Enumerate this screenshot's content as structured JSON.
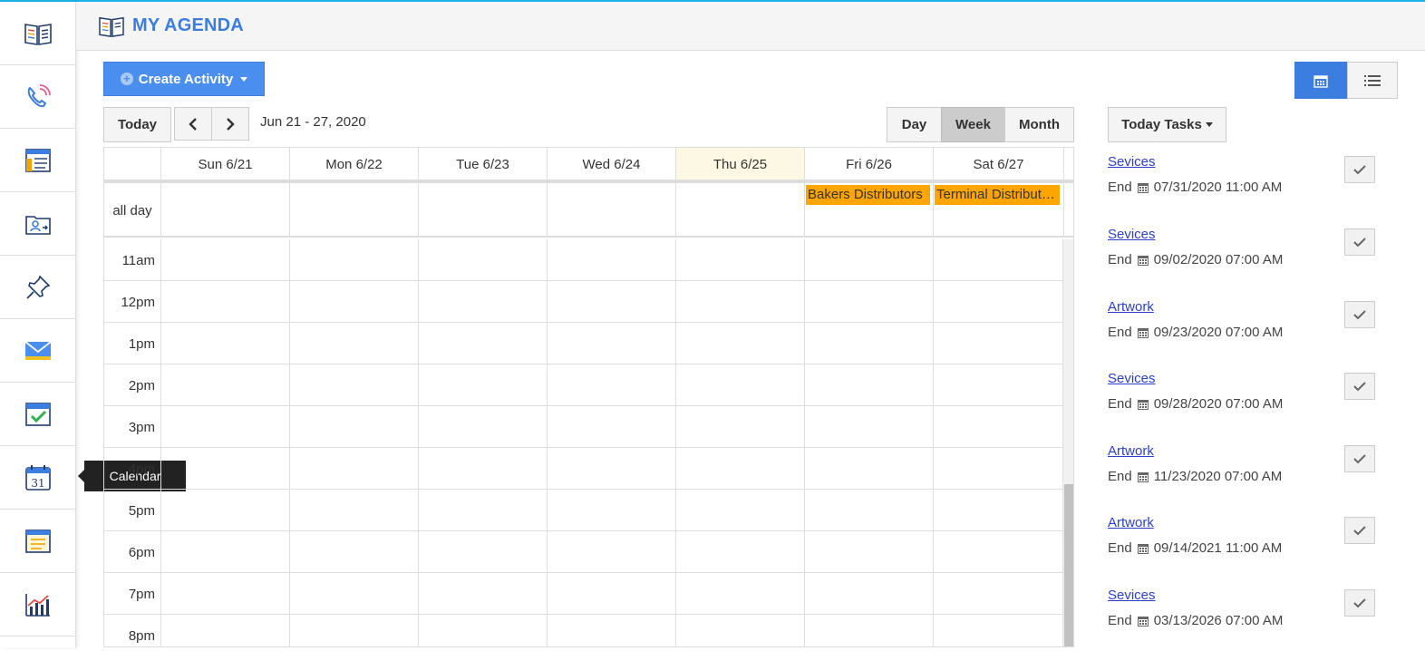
{
  "header": {
    "title": "MY AGENDA"
  },
  "toolbar": {
    "create_label": "Create Activity",
    "today_label": "Today",
    "date_range": "Jun 21 - 27, 2020",
    "view_day": "Day",
    "view_week": "Week",
    "view_month": "Month",
    "tasks_label": "Today Tasks"
  },
  "tooltip": {
    "text": "Calendar"
  },
  "calendar": {
    "days": [
      "Sun 6/21",
      "Mon 6/22",
      "Tue 6/23",
      "Wed 6/24",
      "Thu 6/25",
      "Fri 6/26",
      "Sat 6/27"
    ],
    "allday_label": "all day",
    "events": [
      {
        "title": "Bakers Distributors",
        "day_index": 5
      },
      {
        "title": "Terminal Distributors",
        "day_index": 6
      }
    ],
    "hours": [
      "11am",
      "12pm",
      "1pm",
      "2pm",
      "3pm",
      "4pm",
      "5pm",
      "6pm",
      "7pm",
      "8pm"
    ]
  },
  "tasks": {
    "end_prefix": "End",
    "items": [
      {
        "name": "Sevices",
        "date": "07/31/2020 11:00 AM"
      },
      {
        "name": "Sevices",
        "date": "09/02/2020 07:00 AM"
      },
      {
        "name": "Artwork",
        "date": "09/23/2020 07:00 AM"
      },
      {
        "name": "Sevices",
        "date": "09/28/2020 07:00 AM"
      },
      {
        "name": "Artwork",
        "date": "11/23/2020 07:00 AM"
      },
      {
        "name": "Artwork",
        "date": "09/14/2021 11:00 AM"
      },
      {
        "name": "Sevices",
        "date": "03/13/2026 07:00 AM"
      }
    ]
  },
  "colors": {
    "accent": "#3c7de0",
    "event": "#ffa500",
    "today_column": "#fcf8e3",
    "link": "#2a3fcc"
  }
}
